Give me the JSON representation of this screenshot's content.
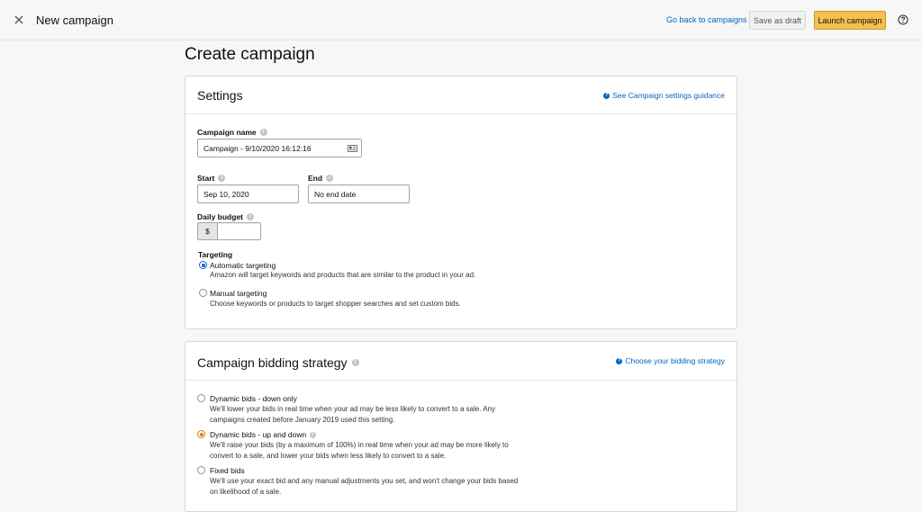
{
  "header": {
    "title": "New campaign",
    "back_link": "Go back to campaigns",
    "save_draft": "Save as draft",
    "launch": "Launch campaign"
  },
  "page": {
    "title": "Create campaign"
  },
  "settings": {
    "title": "Settings",
    "guidance_link": "See Campaign settings guidance",
    "campaign_name_label": "Campaign name",
    "campaign_name_value": "Campaign - 9/10/2020 16:12:16",
    "start_label": "Start",
    "start_value": "Sep 10, 2020",
    "end_label": "End",
    "end_value": "No end date",
    "budget_label": "Daily budget",
    "currency": "$",
    "budget_value": "",
    "targeting_label": "Targeting",
    "targeting_options": [
      {
        "title": "Automatic targeting",
        "desc": "Amazon will target keywords and products that are similar to the product in your ad.",
        "selected": true
      },
      {
        "title": "Manual targeting",
        "desc": "Choose keywords or products to target shopper searches and set custom bids.",
        "selected": false
      }
    ]
  },
  "bidding": {
    "title": "Campaign bidding strategy",
    "guidance_link": "Choose your bidding strategy",
    "options": [
      {
        "title": "Dynamic bids - down only",
        "desc_1": "We'll lower your bids in real time when your ad may be less likely to convert to a sale. Any",
        "desc_2": "campaigns created before January 2019 used this setting.",
        "selected": false
      },
      {
        "title": "Dynamic bids - up and down",
        "desc_1": "We'll raise your bids (by a maximum of 100%) in real time when your ad may be more likely to",
        "desc_2": "convert to a sale, and lower your bids when less likely to convert to a sale.",
        "selected": true
      },
      {
        "title": "Fixed bids",
        "desc_1": "We'll use your exact bid and any manual adjustments you set, and won't change your bids based",
        "desc_2": "on likelihood of a sale.",
        "selected": false
      }
    ]
  },
  "colors": {
    "link": "#0066c0",
    "launch_button": "#f4c04e",
    "selected_radio_blue": "#0a66d9",
    "selected_radio_orange": "#e47911"
  }
}
